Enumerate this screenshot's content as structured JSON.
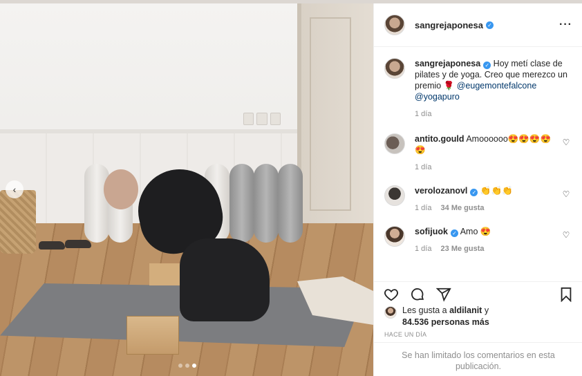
{
  "post": {
    "author": "sangrejaponesa",
    "verified": true,
    "more_icon": "more-horizontal-icon",
    "caption_text": "Hoy metí clase de pilates y de yoga. Creo que merezco un premio 🌹",
    "caption_mentions": [
      "@eugemontefalcone",
      "@yogapuro"
    ],
    "caption_time": "1 día",
    "carousel": {
      "total": 3,
      "active_index": 2
    }
  },
  "comments": [
    {
      "user": "antito.gould",
      "verified": false,
      "text": "Amoooooo😍😍😍😍😍",
      "time": "1 día",
      "likes": ""
    },
    {
      "user": "verolozanovl",
      "verified": true,
      "text": "👏👏👏",
      "time": "1 día",
      "likes": "34 Me gusta"
    },
    {
      "user": "sofijuok",
      "verified": true,
      "text": "Amo 😍",
      "time": "1 día",
      "likes": "23 Me gusta"
    }
  ],
  "actions": {
    "like_icon": "heart-icon",
    "comment_icon": "comment-icon",
    "share_icon": "send-icon",
    "save_icon": "bookmark-icon"
  },
  "likes": {
    "prefix": "Les gusta a ",
    "first_user": "aldilanit",
    "suffix": " y",
    "count_text": "84.536 personas más"
  },
  "timestamp": "HACE UN DÍA",
  "comments_limited_notice": "Se han limitado los comentarios en esta publicación.",
  "colors": {
    "verified": "#3897f0",
    "mention": "#00376b",
    "muted": "#8e8e8e"
  }
}
